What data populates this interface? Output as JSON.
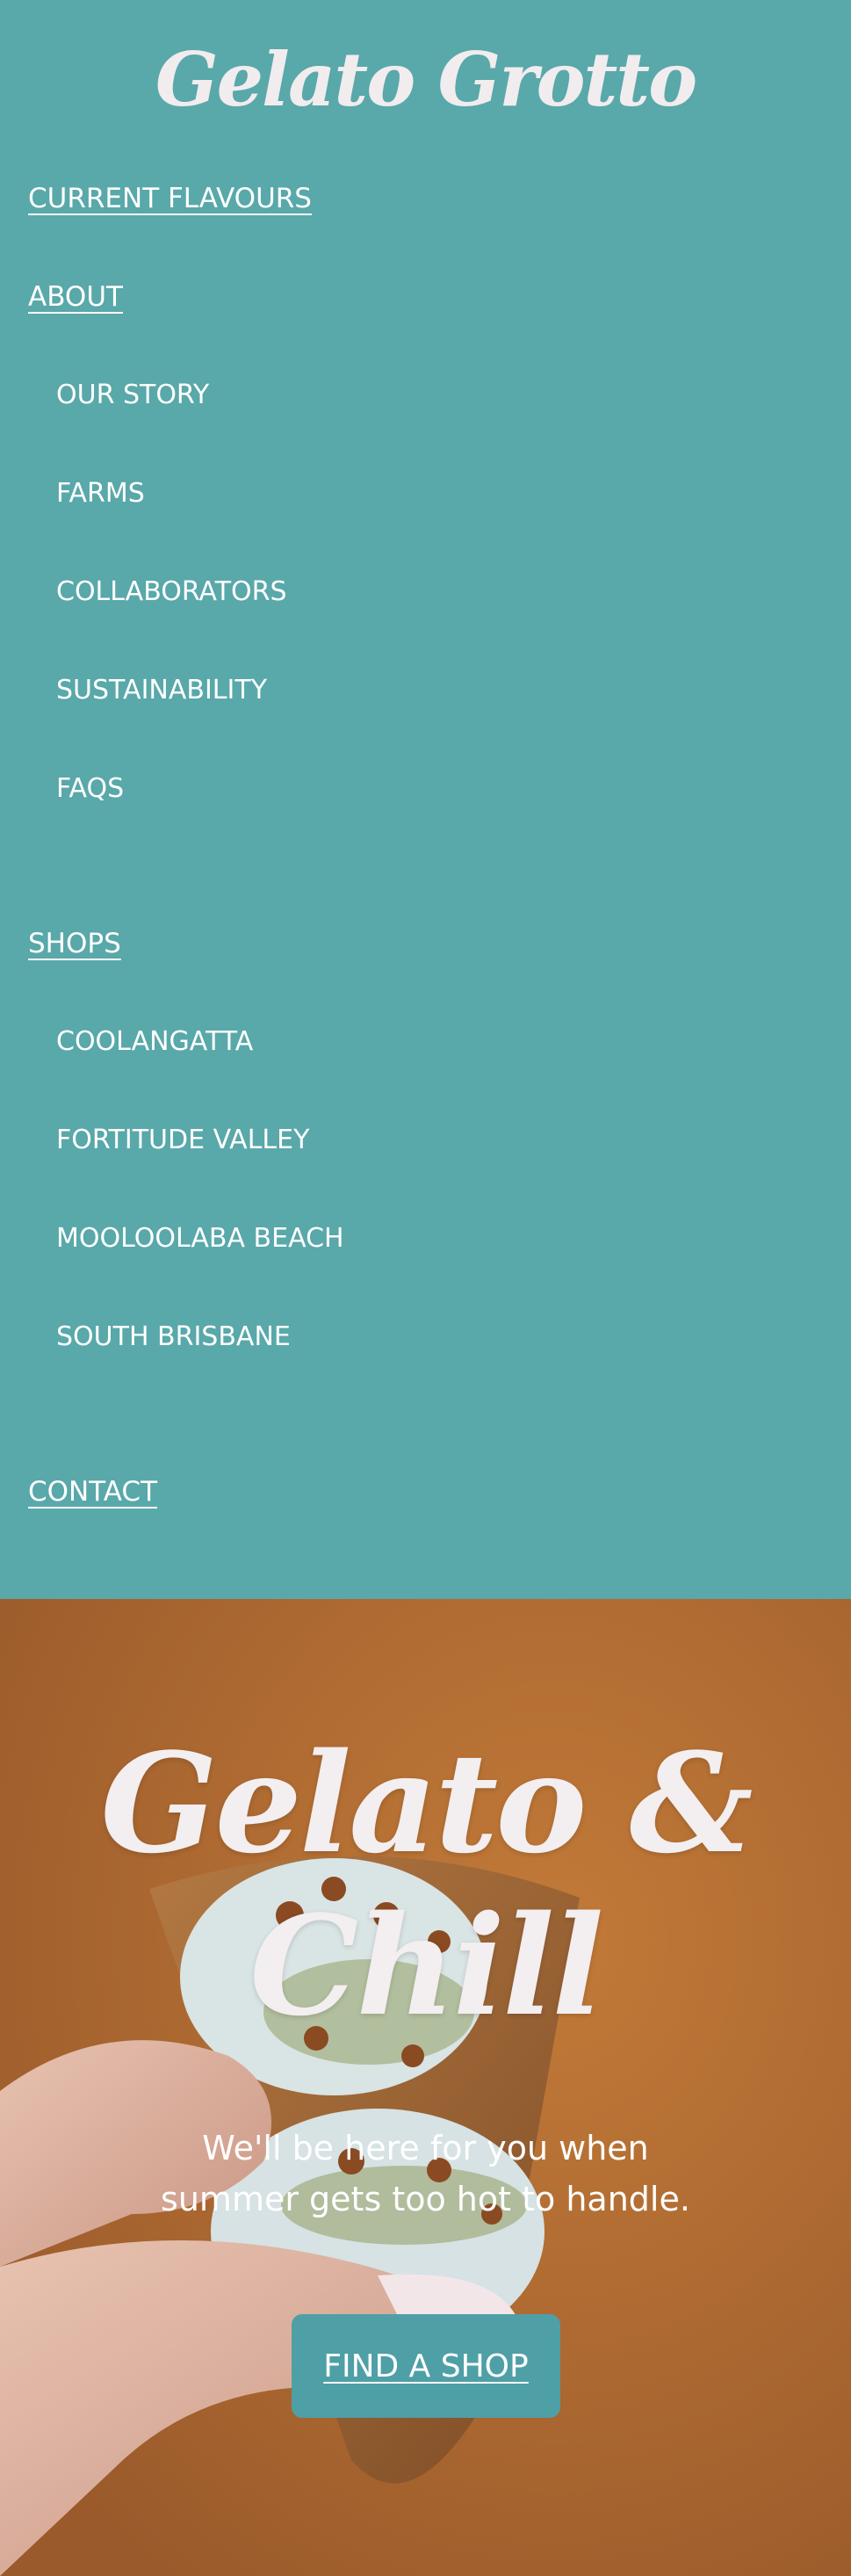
{
  "brand": {
    "logo_text": "Gelato Grotto"
  },
  "nav": {
    "current_flavours": "CURRENT FLAVOURS",
    "about": {
      "label": "ABOUT",
      "items": [
        "OUR STORY",
        "FARMS",
        "COLLABORATORS",
        "SUSTAINABILITY",
        "FAQS"
      ]
    },
    "shops": {
      "label": "SHOPS",
      "items": [
        "COOLANGATTA",
        "FORTITUDE VALLEY",
        "MOOLOOLABA BEACH",
        "SOUTH BRISBANE"
      ]
    },
    "contact": "CONTACT"
  },
  "hero": {
    "title_line1": "Gelato &",
    "title_line2": "Chill",
    "subtitle_line1": "We'll be here for you when",
    "subtitle_line2": "summer gets too hot to handle.",
    "cta_label": "FIND A SHOP"
  },
  "colors": {
    "nav_background": "#59a8aa",
    "hero_background": "#b06a30",
    "button_background": "#4f9fa6",
    "text": "#ffffff"
  }
}
